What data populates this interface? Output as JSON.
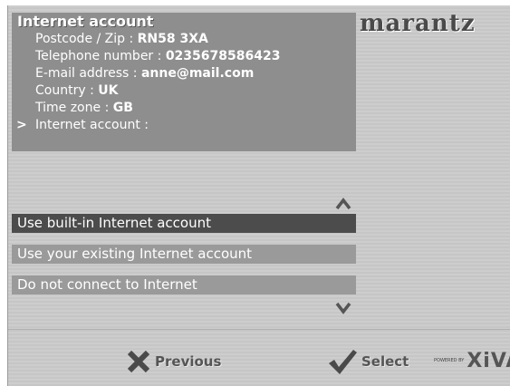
{
  "header": {
    "title": "Internet account",
    "brand": "marantz"
  },
  "info": {
    "rows": [
      {
        "label": "Postcode / Zip : ",
        "value": "RN58 3XA"
      },
      {
        "label": "Telephone number : ",
        "value": "0235678586423"
      },
      {
        "label": "E-mail address : ",
        "value": "anne@mail.com"
      },
      {
        "label": "Country : ",
        "value": "UK"
      },
      {
        "label": "Time zone : ",
        "value": "GB"
      },
      {
        "label": "Internet account :",
        "value": "",
        "cursor": ">"
      }
    ]
  },
  "options": [
    {
      "label": "Use built-in Internet account",
      "selected": true
    },
    {
      "label": "Use your existing Internet account",
      "selected": false
    },
    {
      "label": "Do not connect to Internet",
      "selected": false
    }
  ],
  "footer": {
    "previous_label": "Previous",
    "select_label": "Select",
    "powered_by": "POWERED BY",
    "powered_brand": "XiVA"
  },
  "icons": {
    "previous": "x-icon",
    "select": "checkmark-icon",
    "scroll_up": "chevron-up-icon",
    "scroll_down": "chevron-down-icon"
  },
  "colors": {
    "selected_bg": "#4c4c4c",
    "panel_bg": "#8e8e8e",
    "option_bg": "#9a9a9a",
    "screen_bg": "#cdcdcd"
  }
}
